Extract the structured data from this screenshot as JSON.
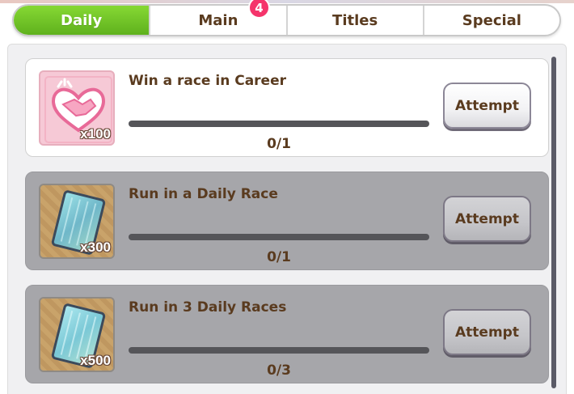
{
  "tabs": [
    {
      "label": "Daily",
      "active": true
    },
    {
      "label": "Main",
      "active": false
    },
    {
      "label": "Titles",
      "active": false
    },
    {
      "label": "Special",
      "active": false
    }
  ],
  "tab_badge": "4",
  "missions": [
    {
      "title": "Win a race in Career",
      "reward_qty": "x100",
      "reward_icon": "handshake-icon",
      "progress_text": "0/1",
      "progress": 0,
      "button_label": "Attempt",
      "state": "available"
    },
    {
      "title": "Run in a Daily Race",
      "reward_qty": "x300",
      "reward_icon": "ticket-card-icon",
      "progress_text": "0/1",
      "progress": 0,
      "button_label": "Attempt",
      "state": "locked"
    },
    {
      "title": "Run in 3 Daily Races",
      "reward_qty": "x500",
      "reward_icon": "ticket-card-icon",
      "progress_text": "0/3",
      "progress": 0,
      "button_label": "Attempt",
      "state": "locked"
    }
  ],
  "colors": {
    "active_tab": "#6bc124",
    "badge": "#f5346b",
    "text_brown": "#5a3b1f",
    "locked_card": "#a6a6aa"
  }
}
